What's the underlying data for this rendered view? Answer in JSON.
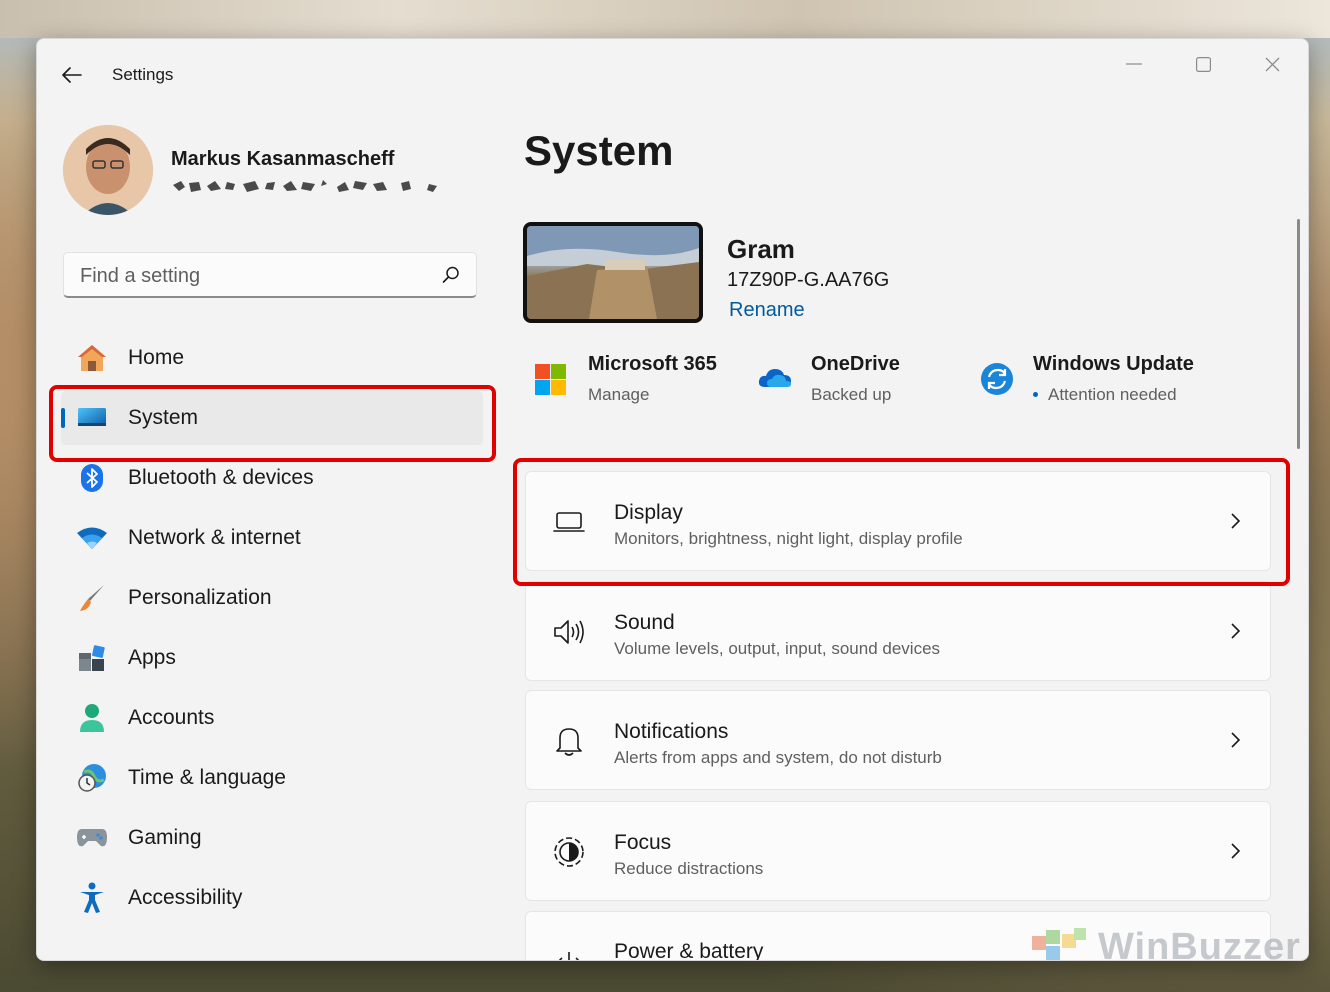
{
  "window": {
    "title": "Settings",
    "controls": [
      "minimize",
      "maximize",
      "close"
    ]
  },
  "profile": {
    "name": "Markus Kasanmascheff"
  },
  "search": {
    "placeholder": "Find a setting"
  },
  "nav": {
    "items": [
      {
        "label": "Home",
        "icon": "home-icon"
      },
      {
        "label": "System",
        "icon": "system-icon",
        "active": true
      },
      {
        "label": "Bluetooth & devices",
        "icon": "bluetooth-icon"
      },
      {
        "label": "Network & internet",
        "icon": "wifi-icon"
      },
      {
        "label": "Personalization",
        "icon": "brush-icon"
      },
      {
        "label": "Apps",
        "icon": "apps-icon"
      },
      {
        "label": "Accounts",
        "icon": "person-icon"
      },
      {
        "label": "Time & language",
        "icon": "globe-clock-icon"
      },
      {
        "label": "Gaming",
        "icon": "gamepad-icon"
      },
      {
        "label": "Accessibility",
        "icon": "accessibility-icon"
      }
    ]
  },
  "main": {
    "title": "System",
    "device": {
      "name": "Gram",
      "model": "17Z90P-G.AA76G",
      "rename_label": "Rename"
    },
    "tiles": [
      {
        "title": "Microsoft 365",
        "subtitle": "Manage",
        "icon": "microsoft-logo-icon"
      },
      {
        "title": "OneDrive",
        "subtitle": "Backed up",
        "icon": "onedrive-cloud-icon"
      },
      {
        "title": "Windows Update",
        "subtitle": "Attention needed",
        "icon": "windows-update-icon"
      }
    ],
    "cards": [
      {
        "title": "Display",
        "subtitle": "Monitors, brightness, night light, display profile",
        "icon": "laptop-icon"
      },
      {
        "title": "Sound",
        "subtitle": "Volume levels, output, input, sound devices",
        "icon": "speaker-icon"
      },
      {
        "title": "Notifications",
        "subtitle": "Alerts from apps and system, do not disturb",
        "icon": "bell-icon"
      },
      {
        "title": "Focus",
        "subtitle": "Reduce distractions",
        "icon": "focus-icon"
      },
      {
        "title": "Power & battery",
        "subtitle": "",
        "icon": "power-icon"
      }
    ]
  },
  "watermark": {
    "text": "WinBuzzer"
  },
  "colors": {
    "accent": "#0067c0",
    "highlight": "#e00000",
    "window_bg": "#f3f3f3",
    "card_bg": "#fbfbfb"
  }
}
